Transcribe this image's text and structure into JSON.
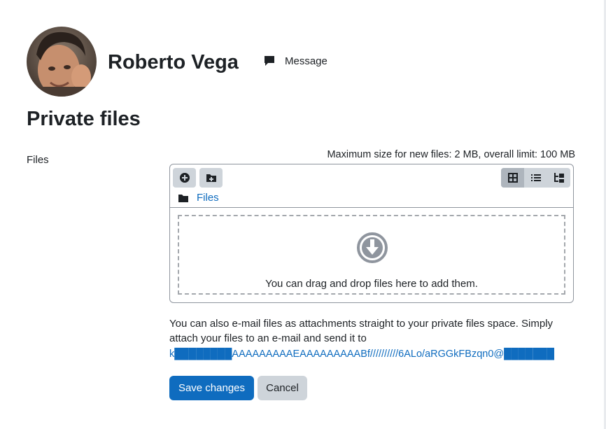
{
  "header": {
    "user_name": "Roberto Vega",
    "message_label": "Message"
  },
  "page": {
    "title": "Private files",
    "field_label": "Files"
  },
  "filemanager": {
    "max_size_text": "Maximum size for new files: 2 MB, overall limit: 100 MB",
    "toolbar": {
      "add_icon": "plus-circle-icon",
      "create_folder_icon": "folder-plus-icon",
      "views": [
        "grid-view-icon",
        "list-view-icon",
        "tree-view-icon"
      ],
      "active_view": "grid-view-icon"
    },
    "path_label": "Files",
    "dropzone_text": "You can drag and drop files here to add them."
  },
  "email_info": {
    "text": "You can also e-mail files as attachments straight to your private files space. Simply attach your files to an e-mail and send it to",
    "address": "k████████AAAAAAAAAEAAAAAAAAABf//////////6ALo/aRGGkFBzqn0@███████"
  },
  "buttons": {
    "save_label": "Save changes",
    "cancel_label": "Cancel"
  },
  "colors": {
    "link": "#0f6cbf",
    "primary": "#0f6cbf",
    "secondary": "#ced4da",
    "text": "#1d2125"
  }
}
